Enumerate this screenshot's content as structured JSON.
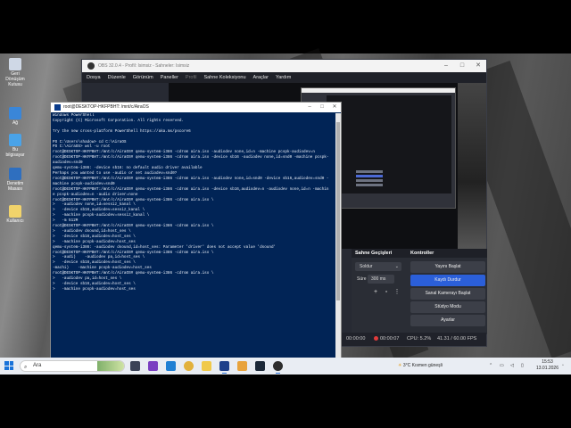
{
  "desktop": {
    "icons": [
      "Geri Dönüşüm Kutusu",
      "Ağ",
      "Bu bilgisayar",
      "Denetim Masası",
      "Kullanıcı"
    ]
  },
  "obs": {
    "title": "OBS 32.0.4 - Profil: Isimsiz - Sahneler: Isimsiz",
    "menu": [
      "Dosya",
      "Düzenle",
      "Görünüm",
      "Paneller",
      "Profil",
      "Sahne Koleksiyonu",
      "Araçlar",
      "Yardım"
    ],
    "transitions": {
      "header": "Sahne Geçişleri",
      "selected": "Soldur",
      "duration_label": "Süre",
      "duration_value": "300 ms"
    },
    "controls": {
      "header": "Kontroller",
      "buttons": [
        "Yayını Başlat",
        "Kaydı Durdur",
        "Sanal Kamerayı Başlat",
        "Stüdyo Modu",
        "Ayarlar"
      ]
    },
    "status": {
      "stream_time": "00:00:00",
      "rec_time": "00:00:07",
      "cpu": "CPU: 5.2%",
      "fps": "41.31 / 60.00 FPS"
    }
  },
  "powershell": {
    "title": "root@DESKTOP-HKFPBHT: /mnt/c/AiraOS",
    "lines": [
      "Windows PowerShell",
      "Copyright (C) Microsoft Corporation. All rights reserved.",
      "",
      "Try the new cross-platform PowerShell https://aka.ms/pscore6",
      "",
      "PS C:\\Users\\shadow> cd C:\\AiraOS",
      "PS C:\\AiraOS> wsl -u root",
      "root@DESKTOP-HKFPBHT:/mnt/c/AiraOS# qemu-system-i386 -cdrom aira.iso -audiodev none,id=n -machine pcspk-audiodev=n",
      "root@DESKTOP-HKFPBHT:/mnt/c/AiraOS# qemu-system-i386 -cdrom aira.iso -device sb16 -audiodev none,id=snd0 -machine pcspk-",
      "audiodev=snd0",
      "qemu-system-i386: -device sb16: no default audio driver available",
      "Perhaps you wanted to use -audio or set audiodev=snd0?",
      "root@DESKTOP-HKFPBHT:/mnt/c/AiraOS# qemu-system-i386 -cdrom aira.iso -audiodev none,id=snd0 -device sb16,audiodev=snd0 -",
      "machine pcspk-audiodev=snd0",
      "root@DESKTOP-HKFPBHT:/mnt/c/AiraOS# qemu-system-i386 -cdrom aira.iso -device sb16,audiodev=n -audiodev none,id=n -machin",
      "e pcspk-audiodev=n -audio driver=none",
      "root@DESKTOP-HKFPBHT:/mnt/c/AiraOS# qemu-system-i386 -cdrom aira.iso \\",
      ">   -audiodev none,id=sessiz_kanal \\",
      ">   -device sb16,audiodev=sessiz_kanal \\",
      ">   -machine pcspk-audiodev=sessiz_kanal \\",
      ">   -m 512M",
      "root@DESKTOP-HKFPBHT:/mnt/c/AiraOS# qemu-system-i386 -cdrom aira.iso \\",
      ">   -audiodev dsound,id=host_ses \\",
      ">   -device sb16,audiodev=host_ses \\",
      ">   -machine pcspk-audiodev=host_ses",
      "qemu-system-i386: -audiodev dsound,id=host_ses: Parameter 'driver' does not accept value 'dsound'",
      "root@DESKTOP-HKFPBHT:/mnt/c/AiraOS# qemu-system-i386 -cdrom aira.iso \\",
      ">   -audi)    -audiodev pa,id=host_ses \\",
      ">   -device sb16,audiodev=host_ses \\",
      "-machi)    -machine pcspk-audiodev=host_ses",
      "root@DESKTOP-HKFPBHT:/mnt/c/AiraOS# qemu-system-i386 -cdrom aira.iso \\",
      ">   -audiodev pa,id=host_ses \\",
      ">   -device sb16,audiodev=host_ses \\",
      ">   -machine pcspk-audiodev=host_ses"
    ]
  },
  "taskbar": {
    "search_placeholder": "Ara",
    "weather": "3°C  Kısmen güneşli",
    "time": "15:53",
    "date": "13.01.2026"
  }
}
